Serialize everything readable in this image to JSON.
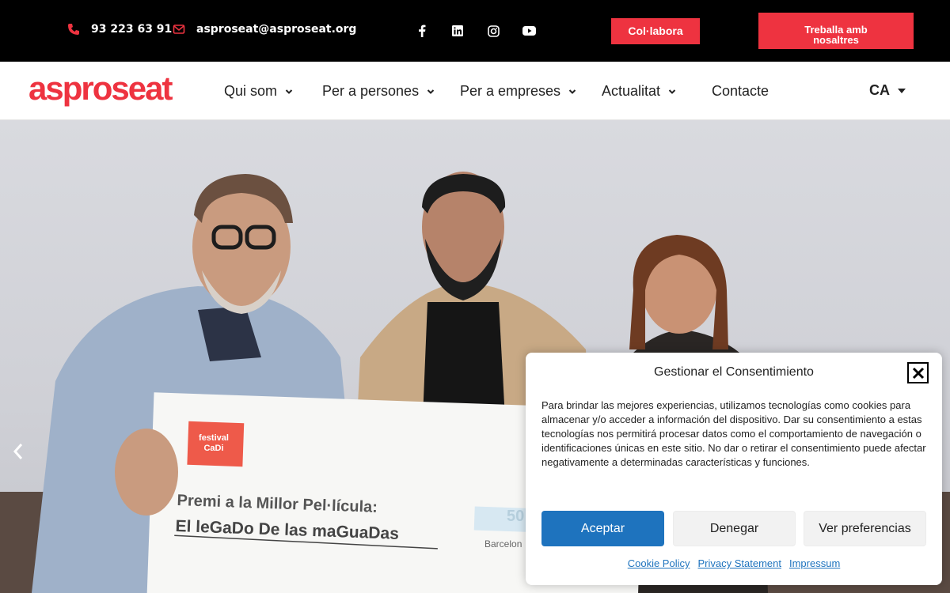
{
  "topbar": {
    "phone": "93 223 63 91",
    "email": "asproseat@asproseat.org",
    "socials": [
      "facebook-icon",
      "linkedin-icon",
      "instagram-icon",
      "youtube-icon"
    ],
    "colabora_label": "Col·labora",
    "treballa_label": "Treballa amb nosaltres"
  },
  "header": {
    "logo": "asproseat",
    "nav": [
      {
        "label": "Qui som",
        "has_dropdown": true
      },
      {
        "label": "Per a persones",
        "has_dropdown": true
      },
      {
        "label": "Per a empreses",
        "has_dropdown": true
      },
      {
        "label": "Actualitat",
        "has_dropdown": true
      },
      {
        "label": "Contacte",
        "has_dropdown": false
      }
    ],
    "language": "CA"
  },
  "hero": {
    "festival_logo": "festival CaDi",
    "cheque_line1": "Premi a la Millor Pel·lícula:",
    "cheque_line2": "El leGaDo De las maGuaDas",
    "cheque_amount_fragment": "50",
    "cheque_city_fragment": "Barcelon"
  },
  "consent": {
    "title": "Gestionar el Consentimiento",
    "body": "Para brindar las mejores experiencias, utilizamos tecnologías como cookies para almacenar y/o acceder a información del dispositivo. Dar su consentimiento a estas tecnologías nos permitirá procesar datos como el comportamiento de navegación o identificaciones únicas en este sitio. No dar o retirar el consentimiento puede afectar negativamente a determinadas características y funciones.",
    "accept": "Aceptar",
    "deny": "Denegar",
    "preferences": "Ver preferencias",
    "links": [
      "Cookie Policy",
      "Privacy Statement",
      "Impressum"
    ]
  },
  "colors": {
    "brand_red": "#ee3340",
    "accept_blue": "#1e73be",
    "topbar_bg": "#000000"
  }
}
